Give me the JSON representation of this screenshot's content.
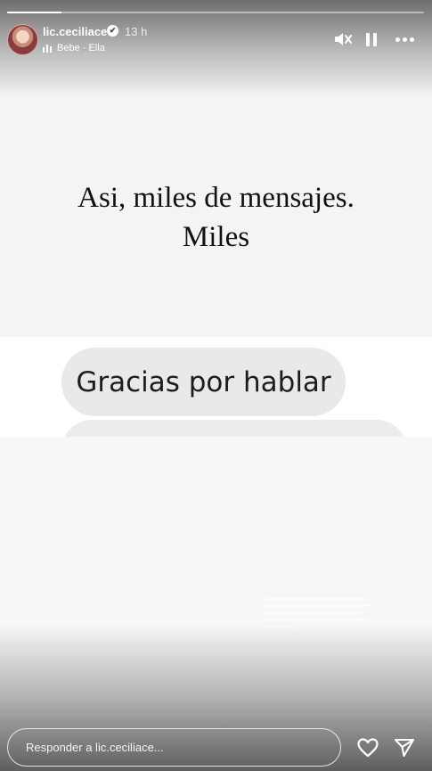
{
  "story": {
    "username": "lic.ceciliace",
    "verified_badge": "✔",
    "time_ago": "13 h",
    "song": "Bebe · Ella",
    "progress": 0.13,
    "icons": [
      "mute-icon",
      "pause-icon",
      "more-icon",
      "verified-icon",
      "music-bars-icon"
    ]
  },
  "content": {
    "headline_line1": "Asi, miles de mensajes.",
    "headline_line2": "Miles",
    "bubble_text": "Gracias por hablar"
  },
  "footer": {
    "reply_placeholder": "Responder a lic.ceciliace...",
    "icons": [
      "heart-icon",
      "send-icon"
    ]
  }
}
